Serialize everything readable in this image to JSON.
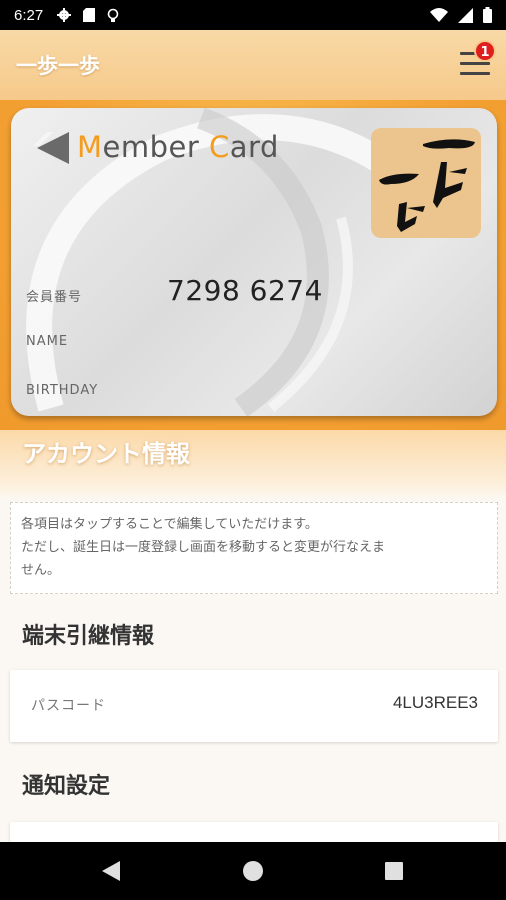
{
  "status_bar": {
    "time": "6:27"
  },
  "app_bar": {
    "title": "一歩一歩",
    "badge_count": "1"
  },
  "member_card": {
    "title_first_letter": "M",
    "title_rest_1": "ember ",
    "title_second_letter": "C",
    "title_rest_2": "ard",
    "number_label": "会員番号",
    "number": "7298 6274",
    "name_label": "NAME",
    "birthday_label": "BIRTHDAY",
    "logo_text": "一歩一歩",
    "accent_color": "#f39c1e"
  },
  "account": {
    "heading": "アカウント情報",
    "notice_line1": "各項目はタップすることで編集していただけます。",
    "notice_line2": "ただし、誕生日は一度登録し画面を移動すると変更が行なえま",
    "notice_line3": "せん。"
  },
  "device_transfer": {
    "heading": "端末引継情報",
    "passcode_label": "パスコード",
    "passcode_value": "4LU3REE3"
  },
  "notifications": {
    "heading": "通知設定"
  },
  "icons": [
    "gear-icon",
    "sd-card-icon",
    "bulb-icon",
    "wifi-icon",
    "signal-icon",
    "battery-icon",
    "menu-icon",
    "back-icon",
    "home-icon",
    "recents-icon"
  ]
}
